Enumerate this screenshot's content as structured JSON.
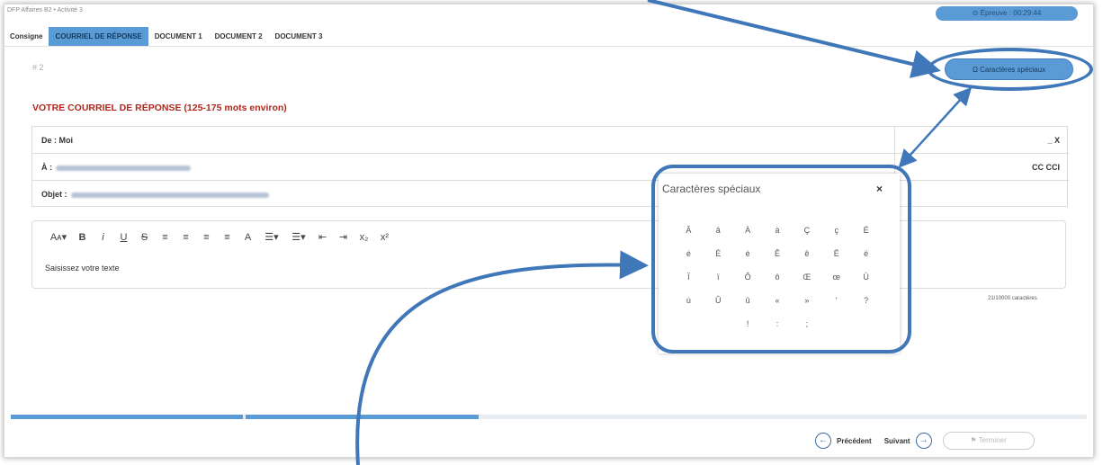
{
  "header": {
    "breadcrumb": "DFP Affaires B2 • Activité 3",
    "timer": "⊙ Épreuve : 00:29:44"
  },
  "tabs": [
    "Consigne",
    "COURRIEL DE RÉPONSE",
    "DOCUMENT 1",
    "DOCUMENT 2",
    "DOCUMENT 3"
  ],
  "active_tab": 1,
  "question_number": "# 2",
  "special_chars_button": "Ω  Caractères spéciaux",
  "section_heading": "VOTRE COURRIEL DE RÉPONSE (125-175 mots environ)",
  "mail": {
    "from_label": "De : Moi",
    "from_right": "_ X",
    "to_label": "À :",
    "to_right": "CC CCI",
    "subject_label": "Objet :"
  },
  "toolbar": [
    "Aᴀ▾",
    "B",
    "i",
    "U",
    "S",
    "≡",
    "≡",
    "≡",
    "≡",
    "A",
    "☰▾",
    "☰▾",
    "⇤",
    "⇥",
    "x₂",
    "x²"
  ],
  "editor_placeholder": "Saisissez votre texte",
  "char_count": "21/10000 caractères",
  "popup": {
    "title": "Caractères spéciaux",
    "close": "×",
    "chars": [
      "Â",
      "â",
      "À",
      "à",
      "Ç",
      "ç",
      "É",
      "é",
      "È",
      "è",
      "Ê",
      "ê",
      "Ë",
      "ë",
      "Ï",
      "ï",
      "Ô",
      "ô",
      "Œ",
      "œ",
      "Ù",
      "ù",
      "Û",
      "û",
      "«",
      "»",
      "'",
      "?",
      "",
      "",
      "!",
      ":",
      ";",
      "",
      ""
    ]
  },
  "progress": {
    "segments": [
      0.216,
      0.216
    ]
  },
  "nav": {
    "prev": "Précédent",
    "next": "Suivant",
    "finish": "⚑  Terminer"
  },
  "colors": {
    "accent": "#5b9bd5",
    "heading": "#b0281e",
    "annotation": "#3f77b8"
  }
}
